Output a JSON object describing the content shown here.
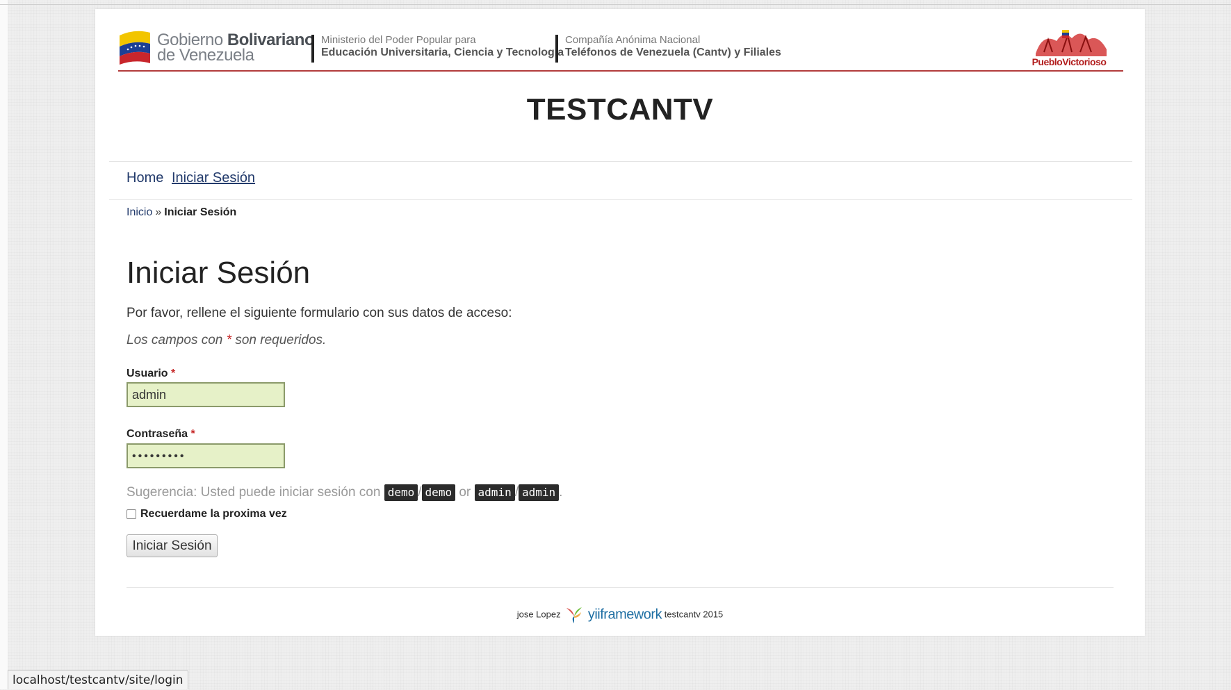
{
  "banner": {
    "gob_line1_a": "Gobierno ",
    "gob_line1_b": "Bolivariano",
    "gob_line2": "de Venezuela",
    "ministry_line1": "Ministerio del Poder Popular para",
    "ministry_line2": "Educación Universitaria, Ciencia y Tecnología",
    "company_line1": "Compañía  Anónima Nacional",
    "company_line2": "Teléfonos de Venezuela (Cantv) y Filiales",
    "logo_text": "PuebloVictorioso"
  },
  "site_title": "TESTCANTV",
  "menu": {
    "items": [
      {
        "label": "Home"
      },
      {
        "label": "Iniciar Sesión"
      }
    ]
  },
  "breadcrumb": {
    "home": "Inicio",
    "separator": "»",
    "current": "Iniciar Sesión"
  },
  "login": {
    "heading": "Iniciar Sesión",
    "intro": "Por favor, rellene el siguiente formulario con sus datos de acceso:",
    "note_before": "Los campos con ",
    "note_star": "*",
    "note_after": " son requeridos.",
    "username_label": "Usuario",
    "username_value": "admin",
    "password_label": "Contraseña",
    "password_value": "•••••••••",
    "required_mark": "*",
    "hint_prefix": "Sugerencia: Usted puede iniciar sesión con ",
    "hint_demo_user": "demo",
    "hint_slash": "/",
    "hint_demo_pass": "demo",
    "hint_or": " or ",
    "hint_admin_user": "admin",
    "hint_admin_pass": "admin",
    "hint_end": ".",
    "remember_label": "Recuerdame la proxima vez",
    "remember_checked": false,
    "submit_label": "Iniciar Sesión"
  },
  "footer": {
    "author": "jose Lopez",
    "framework": "yiiframework",
    "suffix": "testcantv 2015"
  },
  "statusbar": {
    "url": "localhost/testcantv/site/login"
  },
  "colors": {
    "accent_red": "#b23b3b",
    "link_blue": "#223a6b",
    "field_bg": "#e6f1c8",
    "yii_blue": "#1f6fa3"
  }
}
